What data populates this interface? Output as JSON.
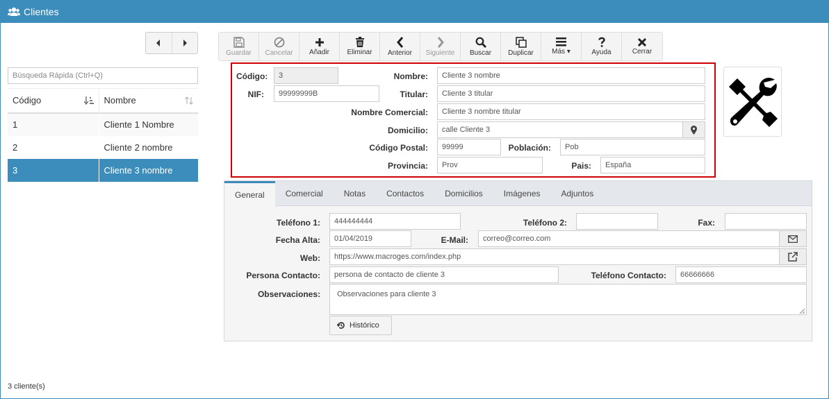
{
  "window": {
    "title": "Clientes",
    "title_icon": "users-icon"
  },
  "nav": {
    "prev_icon": "caret-left-icon",
    "next_icon": "caret-right-icon"
  },
  "search": {
    "placeholder": "Búsqueda Rápida (Ctrl+Q)",
    "value": ""
  },
  "grid": {
    "columns": [
      "Código",
      "Nombre"
    ],
    "rows": [
      {
        "codigo": "1",
        "nombre": "Cliente 1 Nombre"
      },
      {
        "codigo": "2",
        "nombre": "Cliente 2 nombre"
      },
      {
        "codigo": "3",
        "nombre": "Cliente 3 nombre"
      }
    ],
    "selected_index": 2
  },
  "toolbar": {
    "buttons": [
      {
        "label": "Guardar",
        "icon": "save-icon",
        "enabled": false
      },
      {
        "label": "Cancelar",
        "icon": "ban-icon",
        "enabled": false
      },
      {
        "label": "Añadir",
        "icon": "plus-icon",
        "enabled": true
      },
      {
        "label": "Eliminar",
        "icon": "trash-icon",
        "enabled": true
      },
      {
        "label": "Anterior",
        "icon": "chevron-left-icon",
        "enabled": true
      },
      {
        "label": "Siguiente",
        "icon": "chevron-right-icon",
        "enabled": false
      },
      {
        "label": "Buscar",
        "icon": "search-icon",
        "enabled": true
      },
      {
        "label": "Duplicar",
        "icon": "copy-icon",
        "enabled": true
      },
      {
        "label": "Más",
        "icon": "bars-icon",
        "enabled": true
      },
      {
        "label": "Ayuda",
        "icon": "question-icon",
        "enabled": true
      },
      {
        "label": "Cerrar",
        "icon": "close-icon",
        "enabled": true
      }
    ]
  },
  "header_form": {
    "codigo_label": "Código:",
    "codigo_value": "3",
    "nombre_label": "Nombre:",
    "nombre_value": "Cliente 3 nombre",
    "nif_label": "NIF:",
    "nif_value": "99999999B",
    "titular_label": "Titular:",
    "titular_value": "Cliente 3 titular",
    "nombre_comercial_label": "Nombre Comercial:",
    "nombre_comercial_value": "Cliente 3 nombre titular",
    "domicilio_label": "Domicilio:",
    "domicilio_value": "calle Cliente 3",
    "codigo_postal_label": "Código Postal:",
    "codigo_postal_value": "99999",
    "poblacion_label": "Población:",
    "poblacion_value": "Pob",
    "provincia_label": "Provincia:",
    "provincia_value": "Prov",
    "pais_label": "Pais:",
    "pais_value": "España"
  },
  "logo": {
    "icon": "wrench-screwdriver-icon"
  },
  "tabs": [
    "General",
    "Comercial",
    "Notas",
    "Contactos",
    "Domicilios",
    "Imágenes",
    "Adjuntos"
  ],
  "general": {
    "telefono1_label": "Teléfono 1:",
    "telefono1_value": "444444444",
    "telefono2_label": "Teléfono 2:",
    "telefono2_value": "",
    "fax_label": "Fax:",
    "fax_value": "",
    "fecha_alta_label": "Fecha Alta:",
    "fecha_alta_value": "01/04/2019",
    "email_label": "E-Mail:",
    "email_value": "correo@correo.com",
    "web_label": "Web:",
    "web_value": "https://www.macroges.com/index.php",
    "persona_contacto_label": "Persona Contacto:",
    "persona_contacto_value": "persona de contacto de cliente 3",
    "telefono_contacto_label": "Teléfono Contacto:",
    "telefono_contacto_value": "66666666",
    "observaciones_label": "Observaciones:",
    "observaciones_value": "Observaciones para cliente 3",
    "historico_label": "Histórico"
  },
  "footer": {
    "count_text": "3 cliente(s)"
  },
  "colors": {
    "accent": "#3c8dbc",
    "highlight_border": "#cc0000"
  }
}
